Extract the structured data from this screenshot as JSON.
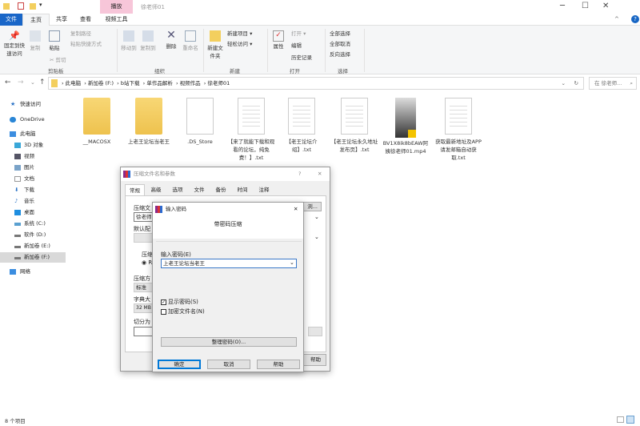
{
  "window": {
    "title": "徐老师01",
    "context_tab": "播放",
    "minimize": "─",
    "maximize": "☐",
    "close": "✕"
  },
  "ribbon_tabs": [
    "文件",
    "主页",
    "共享",
    "查看",
    "视频工具"
  ],
  "ribbon": {
    "pin": "固定到快速访问",
    "copy": "复制",
    "paste": "粘贴",
    "copy_path": "复制路径",
    "paste_shortcut": "粘贴快捷方式",
    "cut": "剪切",
    "group_clipboard": "剪贴板",
    "move_to": "移动到",
    "copy_to": "复制到",
    "delete": "删除",
    "rename": "重命名",
    "group_organize": "组织",
    "new_folder": "新建文件夹",
    "new_item": "新建项目 ▾",
    "easy_access": "轻松访问 ▾",
    "group_new": "新建",
    "properties": "属性",
    "open": "打开 ▾",
    "edit": "编辑",
    "history": "历史记录",
    "group_open": "打开",
    "select_all": "全部选择",
    "select_none": "全部取消",
    "invert": "反向选择",
    "group_select": "选择"
  },
  "address": {
    "crumbs": [
      "此电脑",
      "新加卷 (F:)",
      "b站下载",
      "单作品解析",
      "视频作品",
      "徐老师01"
    ],
    "search_placeholder": "在 徐老师..."
  },
  "nav": [
    "快速访问",
    "OneDrive",
    "此电脑",
    "3D 对象",
    "视频",
    "图片",
    "文档",
    "下载",
    "音乐",
    "桌面",
    "系统 (C:)",
    "软件 (D:)",
    "新加卷 (E:)",
    "新加卷 (F:)",
    "网络"
  ],
  "files": [
    {
      "name": "__MACOSX",
      "type": "folder"
    },
    {
      "name": "上老王论坛当老王",
      "type": "folder"
    },
    {
      "name": ".DS_Store",
      "type": "file"
    },
    {
      "name": "【来了就能下载和观看的论坛，纯免费！】.txt",
      "type": "txt"
    },
    {
      "name": "【老王论坛介绍】.txt",
      "type": "txt"
    },
    {
      "name": "【老王论坛永久地址发布页】.txt",
      "type": "txt"
    },
    {
      "name": "BV1X8ik8bEAW阿姨徐老师01.mp4",
      "type": "video"
    },
    {
      "name": "获取最新地址及APP请发邮箱自动获取.txt",
      "type": "txt"
    }
  ],
  "status": "8 个项目",
  "archive_dialog": {
    "title": "压缩文件名和参数",
    "help": "?",
    "close": "✕",
    "tabs": [
      "常规",
      "高级",
      "选项",
      "文件",
      "备份",
      "时间",
      "注释"
    ],
    "archive_name_label": "压缩文",
    "archive_name_value": "徐老师",
    "browse": "浏...",
    "default_profile": "默认配",
    "format_label": "压缩文",
    "format_rar": "RA",
    "method_label": "压缩方",
    "method_value": "标准",
    "dict_label": "字典大",
    "dict_value": "32 MB",
    "split_label": "切分为",
    "help_button": "帮助"
  },
  "password_dialog": {
    "title": "输入密码",
    "close": "✕",
    "heading": "带密码压缩",
    "password_label": "输入密码(E)",
    "password_value": "上老王论坛当老王",
    "show_password": "显示密码(S)",
    "show_password_checked": true,
    "encrypt_names": "加密文件名(N)",
    "encrypt_names_checked": false,
    "organize": "整理密码(O)...",
    "ok": "确定",
    "cancel": "取消",
    "help": "帮助"
  }
}
